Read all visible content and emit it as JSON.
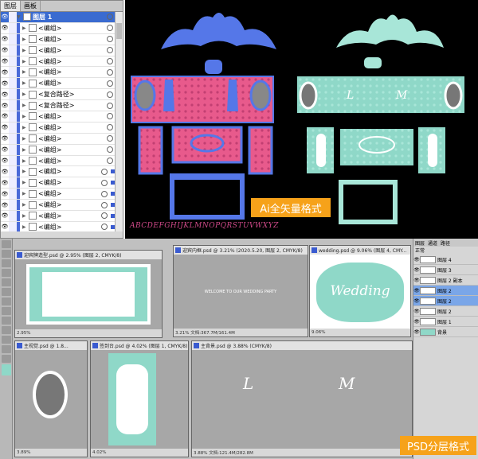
{
  "ai_panel": {
    "tabs": [
      "图层",
      "画板"
    ],
    "top_layer": "图层 1",
    "rows": [
      {
        "label": "<编组>",
        "mark": false
      },
      {
        "label": "<编组>",
        "mark": false
      },
      {
        "label": "<编组>",
        "mark": false
      },
      {
        "label": "<编组>",
        "mark": false
      },
      {
        "label": "<编组>",
        "mark": false
      },
      {
        "label": "<编组>",
        "mark": false
      },
      {
        "label": "<复合路径>",
        "mark": false
      },
      {
        "label": "<复合路径>",
        "mark": false
      },
      {
        "label": "<编组>",
        "mark": false
      },
      {
        "label": "<编组>",
        "mark": false
      },
      {
        "label": "<编组>",
        "mark": false
      },
      {
        "label": "<编组>",
        "mark": false
      },
      {
        "label": "<编组>",
        "mark": false
      },
      {
        "label": "<编组>",
        "mark": true
      },
      {
        "label": "<编组>",
        "mark": true
      },
      {
        "label": "<编组>",
        "mark": true
      },
      {
        "label": "<编组>",
        "mark": true
      },
      {
        "label": "<编组>",
        "mark": true
      },
      {
        "label": "<编组>",
        "mark": true
      },
      {
        "label": "<编组>",
        "mark": true
      }
    ]
  },
  "ai_canvas": {
    "badge": "Ai全矢量格式",
    "alphabet": "ABCDEFGHIJKLMNOPQRSTUVWXYZ",
    "card_text_left": "L",
    "card_text_right": "M",
    "wedding_line": "WELCOME TO OUR WEDDING PARTY"
  },
  "ps_docs": [
    {
      "title": "迎宾牌造型.psd @ 2.95% (图层 2, CMYK/8)",
      "status": "2.95%"
    },
    {
      "title": "迎宾内框.psd @ 3.21% (2020.5.20, 图层 2, CMYK/8)",
      "status": "3.21%   文档:367.7M/161.4M"
    },
    {
      "title": "wedding.psd @ 9.06% (图层 4, CMY...",
      "status": "9.06%"
    },
    {
      "title": "主视觉.psd @ 1.8...",
      "status": "3.89%"
    },
    {
      "title": "签到台.psd @ 4.02% (图层 1, CMYK/8)",
      "status": "4.02%"
    },
    {
      "title": "主背景.psd @ 3.88% (CMYK/8)",
      "status": "3.88%   文档:121.4M/282.8M"
    }
  ],
  "wedding_script": "Wedding",
  "ps_layers": {
    "tabs": [
      "图层",
      "通道",
      "路径"
    ],
    "blend": "正常",
    "rows": [
      {
        "label": "图层 4",
        "selected": false
      },
      {
        "label": "图层 3",
        "selected": false
      },
      {
        "label": "图层 2 副本",
        "selected": false
      },
      {
        "label": "图层 2",
        "selected": true
      },
      {
        "label": "图层 2",
        "selected": true
      },
      {
        "label": "图层 2",
        "selected": false
      },
      {
        "label": "图层 1",
        "selected": false
      },
      {
        "label": "背景",
        "selected": false
      }
    ]
  },
  "psd_badge": "PSD分层格式",
  "colors": {
    "teal": "#8fd8c8",
    "pink": "#e85a8c",
    "blue": "#5577e8",
    "badge": "#f6a21a"
  }
}
